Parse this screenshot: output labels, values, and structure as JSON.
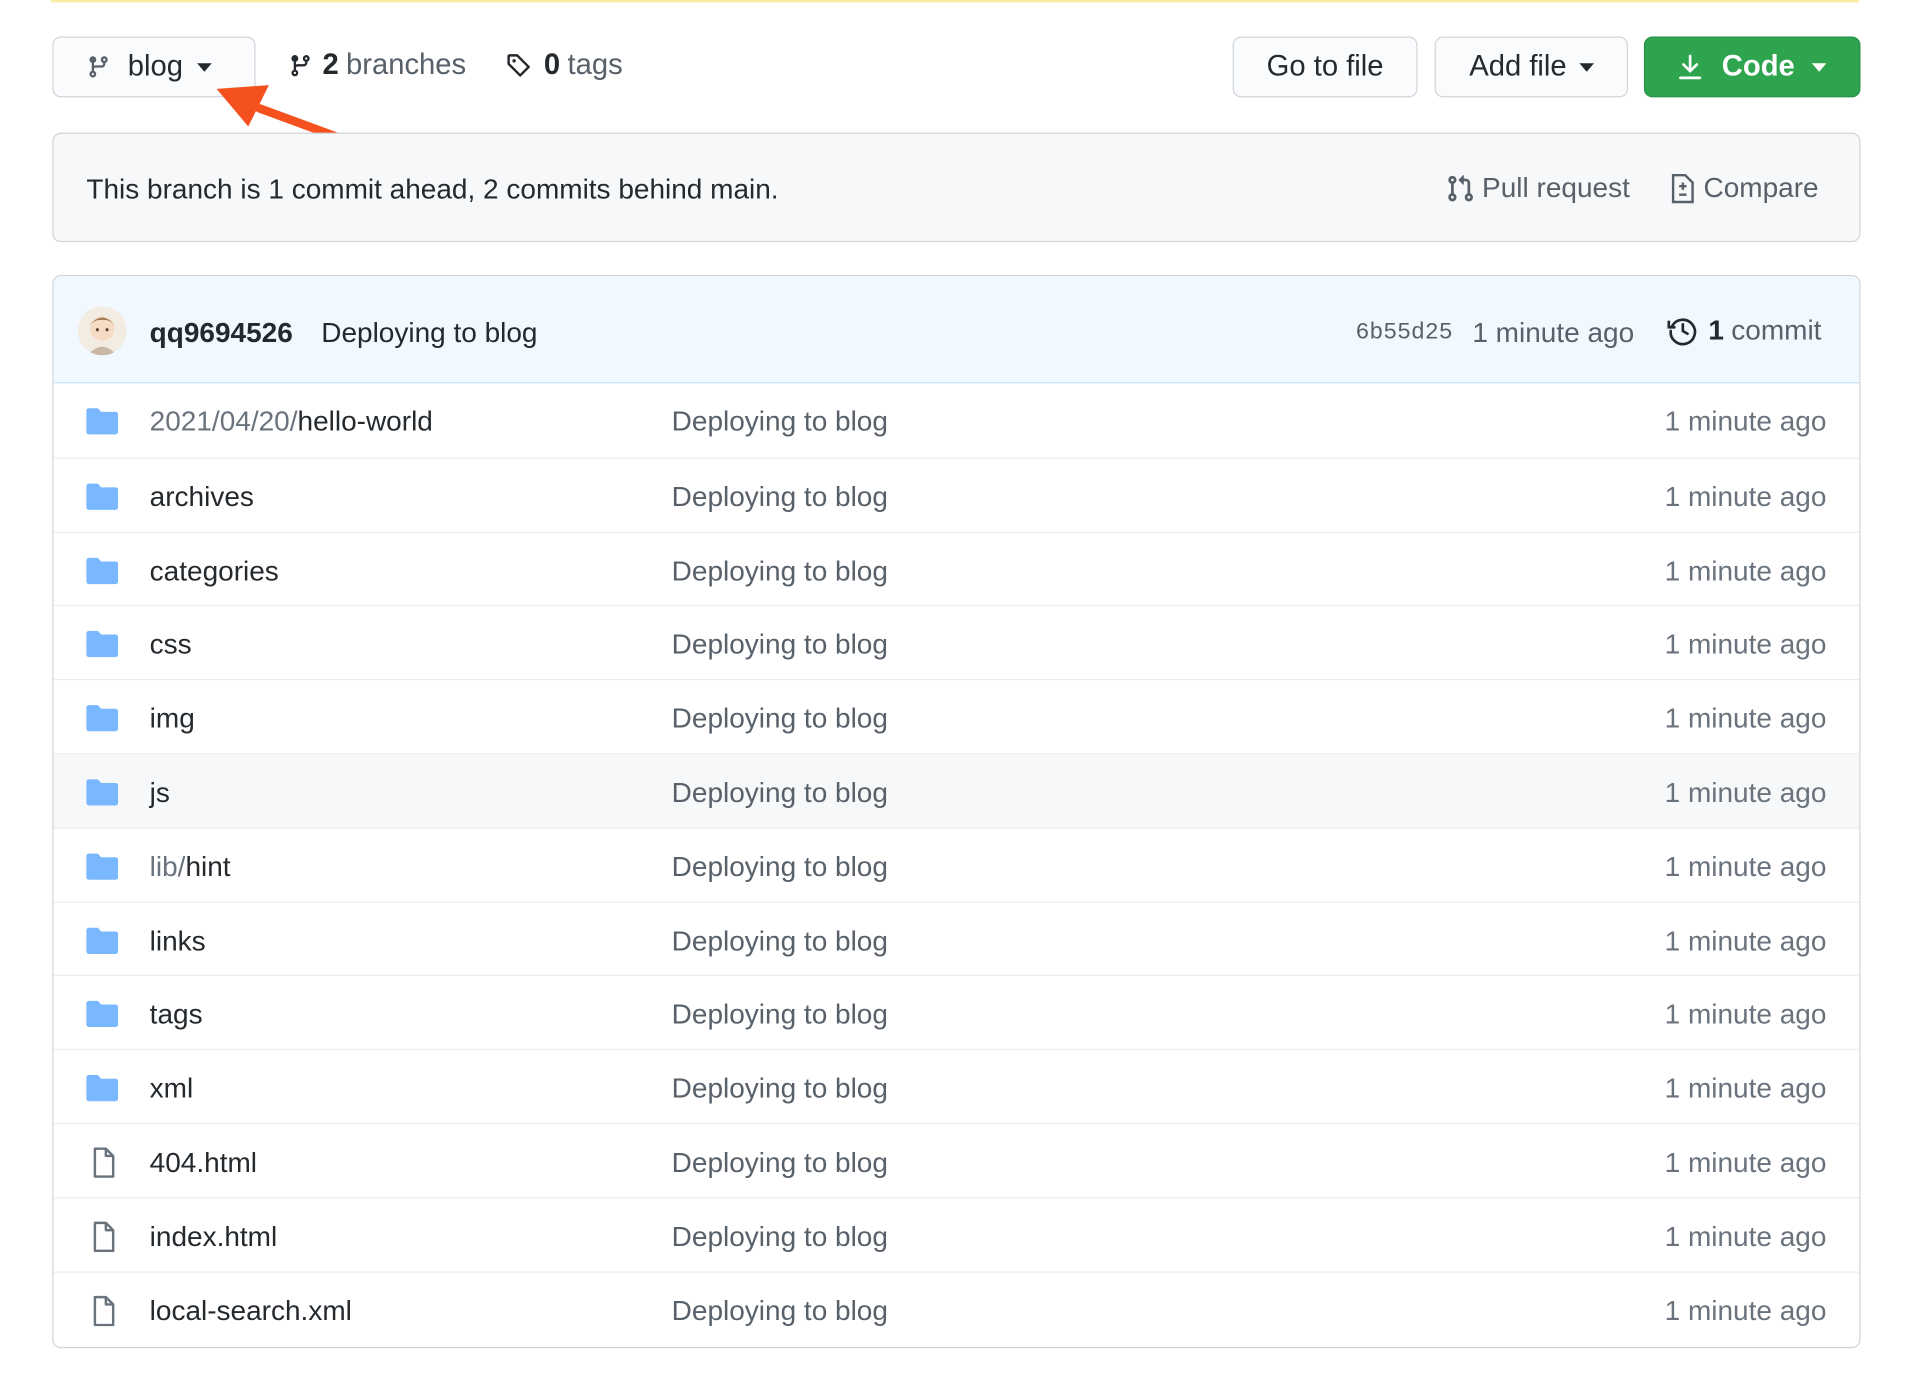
{
  "toolbar": {
    "branch_name": "blog",
    "branch_count": "2",
    "branch_label": "branches",
    "tag_count": "0",
    "tag_label": "tags",
    "go_to_file": "Go to file",
    "add_file": "Add file",
    "code": "Code"
  },
  "banner": {
    "text": "This branch is 1 commit ahead, 2 commits behind main.",
    "pull_request": "Pull request",
    "compare": "Compare"
  },
  "latest_commit": {
    "author": "qq9694526",
    "message": "Deploying to blog",
    "sha": "6b55d25",
    "time": "1 minute ago",
    "count": "1",
    "count_label": "commit"
  },
  "files": [
    {
      "prefix": "2021/04/20/",
      "name": "hello-world",
      "type": "folder",
      "message": "Deploying to blog",
      "age": "1 minute ago"
    },
    {
      "prefix": "",
      "name": "archives",
      "type": "folder",
      "message": "Deploying to blog",
      "age": "1 minute ago"
    },
    {
      "prefix": "",
      "name": "categories",
      "type": "folder",
      "message": "Deploying to blog",
      "age": "1 minute ago"
    },
    {
      "prefix": "",
      "name": "css",
      "type": "folder",
      "message": "Deploying to blog",
      "age": "1 minute ago"
    },
    {
      "prefix": "",
      "name": "img",
      "type": "folder",
      "message": "Deploying to blog",
      "age": "1 minute ago"
    },
    {
      "prefix": "",
      "name": "js",
      "type": "folder",
      "message": "Deploying to blog",
      "age": "1 minute ago",
      "highlight": true
    },
    {
      "prefix": "lib/",
      "name": "hint",
      "type": "folder",
      "message": "Deploying to blog",
      "age": "1 minute ago"
    },
    {
      "prefix": "",
      "name": "links",
      "type": "folder",
      "message": "Deploying to blog",
      "age": "1 minute ago"
    },
    {
      "prefix": "",
      "name": "tags",
      "type": "folder",
      "message": "Deploying to blog",
      "age": "1 minute ago"
    },
    {
      "prefix": "",
      "name": "xml",
      "type": "folder",
      "message": "Deploying to blog",
      "age": "1 minute ago"
    },
    {
      "prefix": "",
      "name": "404.html",
      "type": "file",
      "message": "Deploying to blog",
      "age": "1 minute ago"
    },
    {
      "prefix": "",
      "name": "index.html",
      "type": "file",
      "message": "Deploying to blog",
      "age": "1 minute ago"
    },
    {
      "prefix": "",
      "name": "local-search.xml",
      "type": "file",
      "message": "Deploying to blog",
      "age": "1 minute ago"
    }
  ],
  "colors": {
    "code_button": "#2ea44f",
    "folder": "#79b8ff",
    "annotation_arrow": "#f4511e"
  },
  "icons": [
    "git-branch-icon",
    "tag-icon",
    "download-icon",
    "pull-request-icon",
    "compare-icon",
    "history-icon",
    "folder-icon",
    "file-icon"
  ]
}
